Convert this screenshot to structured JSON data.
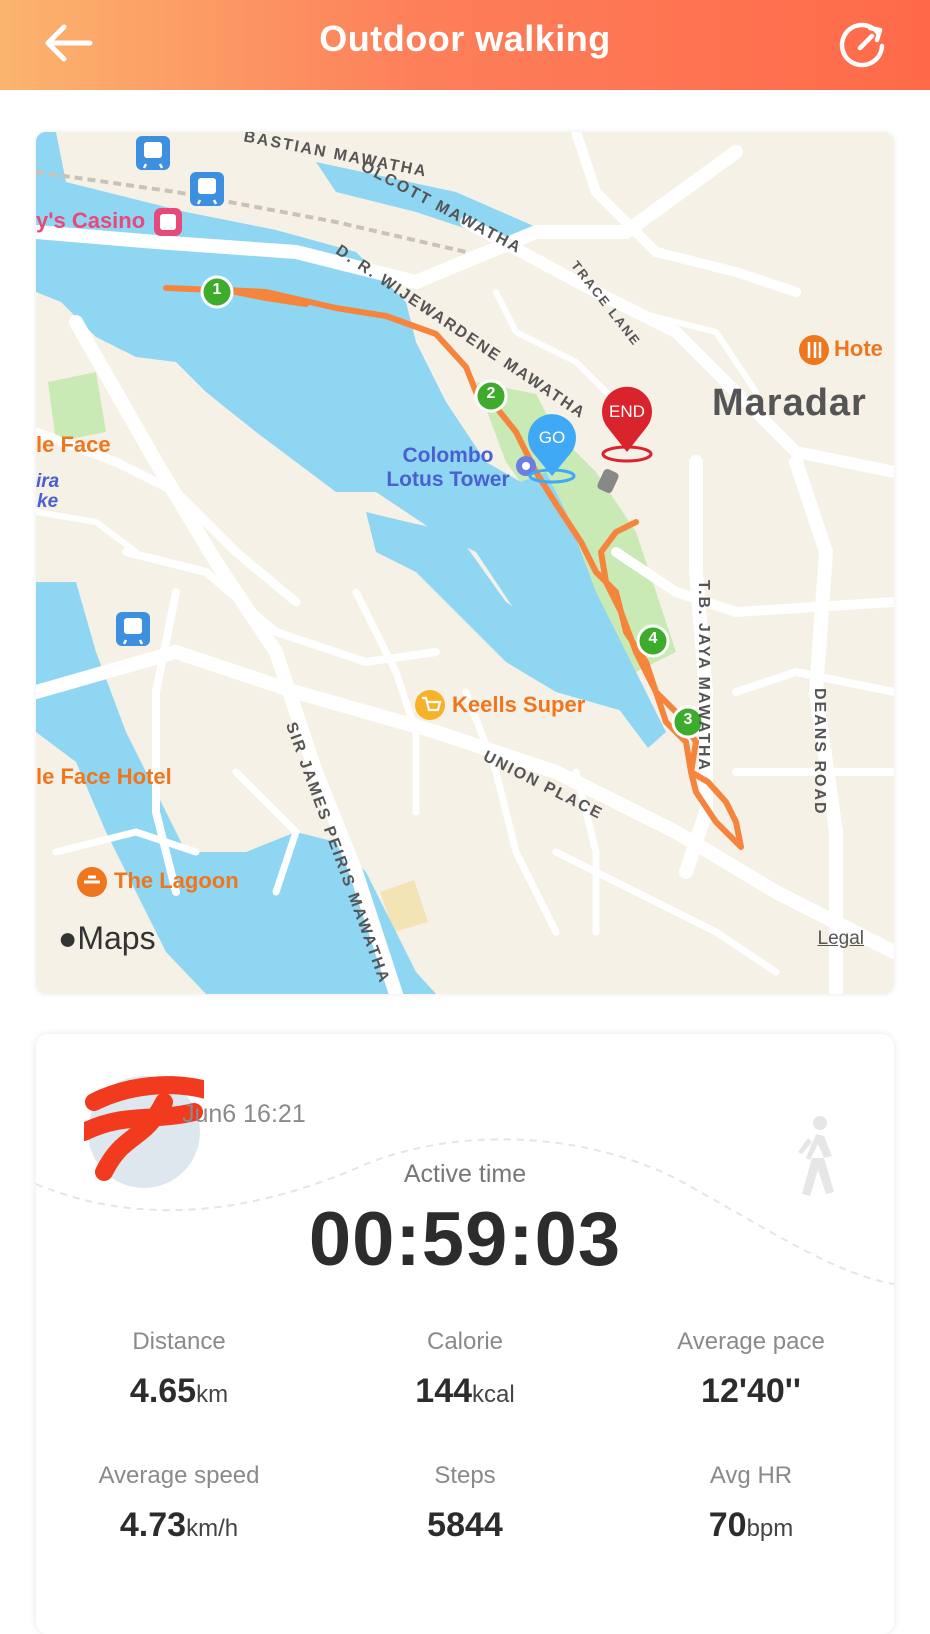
{
  "header": {
    "title": "Outdoor walking",
    "back_icon": "arrow-left-icon",
    "share_icon": "share-refresh-icon"
  },
  "map": {
    "roads": {
      "bastian": "BASTIAN MAWATHA",
      "olcott": "OLCOTT MAWATHA",
      "wijewardene": "D. R. WIJEWARDENE MAWATHA",
      "trace_lane": "TRACE LANE",
      "tb_jaya": "T.B. JAYA MAWATHA",
      "deans": "DEANS ROAD",
      "union": "UNION PLACE",
      "james_peiris": "SIR JAMES PEIRIS MAWATHA"
    },
    "pois": {
      "casino": "y's Casino",
      "lotus_tower_line1": "Colombo",
      "lotus_tower_line2": "Lotus Tower",
      "keells": "Keells Super",
      "lagoon": "The Lagoon",
      "face_hotel": "le Face Hotel",
      "face": "le Face",
      "hotel": "Hote",
      "ira": "ira",
      "ke": "ke"
    },
    "city": "Maradar",
    "markers": {
      "go": "GO",
      "end": "END",
      "km1": "1",
      "km2": "2",
      "km3": "3",
      "km4": "4"
    },
    "attribution": "Maps",
    "legal": "Legal"
  },
  "summary": {
    "datetime": "Jun6 16:21",
    "activity_icon": "walking-person-icon",
    "active_time_label": "Active time",
    "active_time": "00:59:03",
    "metrics": [
      {
        "label": "Distance",
        "value": "4.65",
        "unit": "km"
      },
      {
        "label": "Calorie",
        "value": "144",
        "unit": "kcal"
      },
      {
        "label": "Average pace",
        "value": "12'40''",
        "unit": ""
      },
      {
        "label": "Average speed",
        "value": "4.73",
        "unit": "km/h"
      },
      {
        "label": "Steps",
        "value": "5844",
        "unit": ""
      },
      {
        "label": "Avg HR",
        "value": "70",
        "unit": "bpm"
      }
    ]
  },
  "colors": {
    "header_start": "#fbb46e",
    "header_end": "#fe6a4a",
    "route": "#f5843c",
    "water": "#8fd6f2",
    "km_marker": "#3dab2b",
    "go_marker": "#3fa9f5",
    "end_marker": "#d9232d"
  }
}
